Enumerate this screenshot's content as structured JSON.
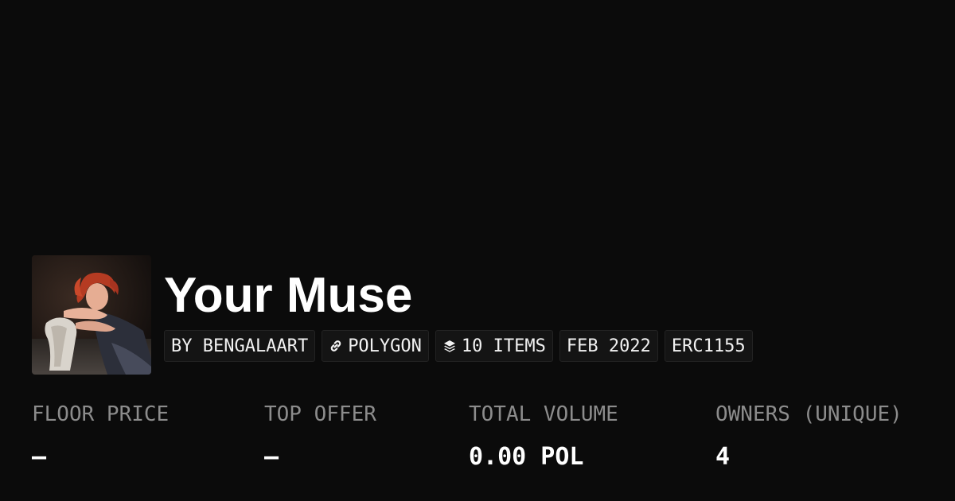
{
  "collection": {
    "title": "Your Muse"
  },
  "badges": {
    "creator": "BY BENGALAART",
    "chain": "POLYGON",
    "chain_icon": "link-icon",
    "items": "10 ITEMS",
    "items_icon": "layers-icon",
    "date": "FEB 2022",
    "standard": "ERC1155"
  },
  "stats": [
    {
      "label": "FLOOR PRICE",
      "value": "—"
    },
    {
      "label": "TOP OFFER",
      "value": "—"
    },
    {
      "label": "TOTAL VOLUME",
      "value": "0.00 POL"
    },
    {
      "label": "OWNERS (UNIQUE)",
      "value": "4"
    }
  ],
  "colors": {
    "background": "#0b0b0b",
    "label_gray": "#8c8c8c",
    "text": "#ffffff"
  }
}
